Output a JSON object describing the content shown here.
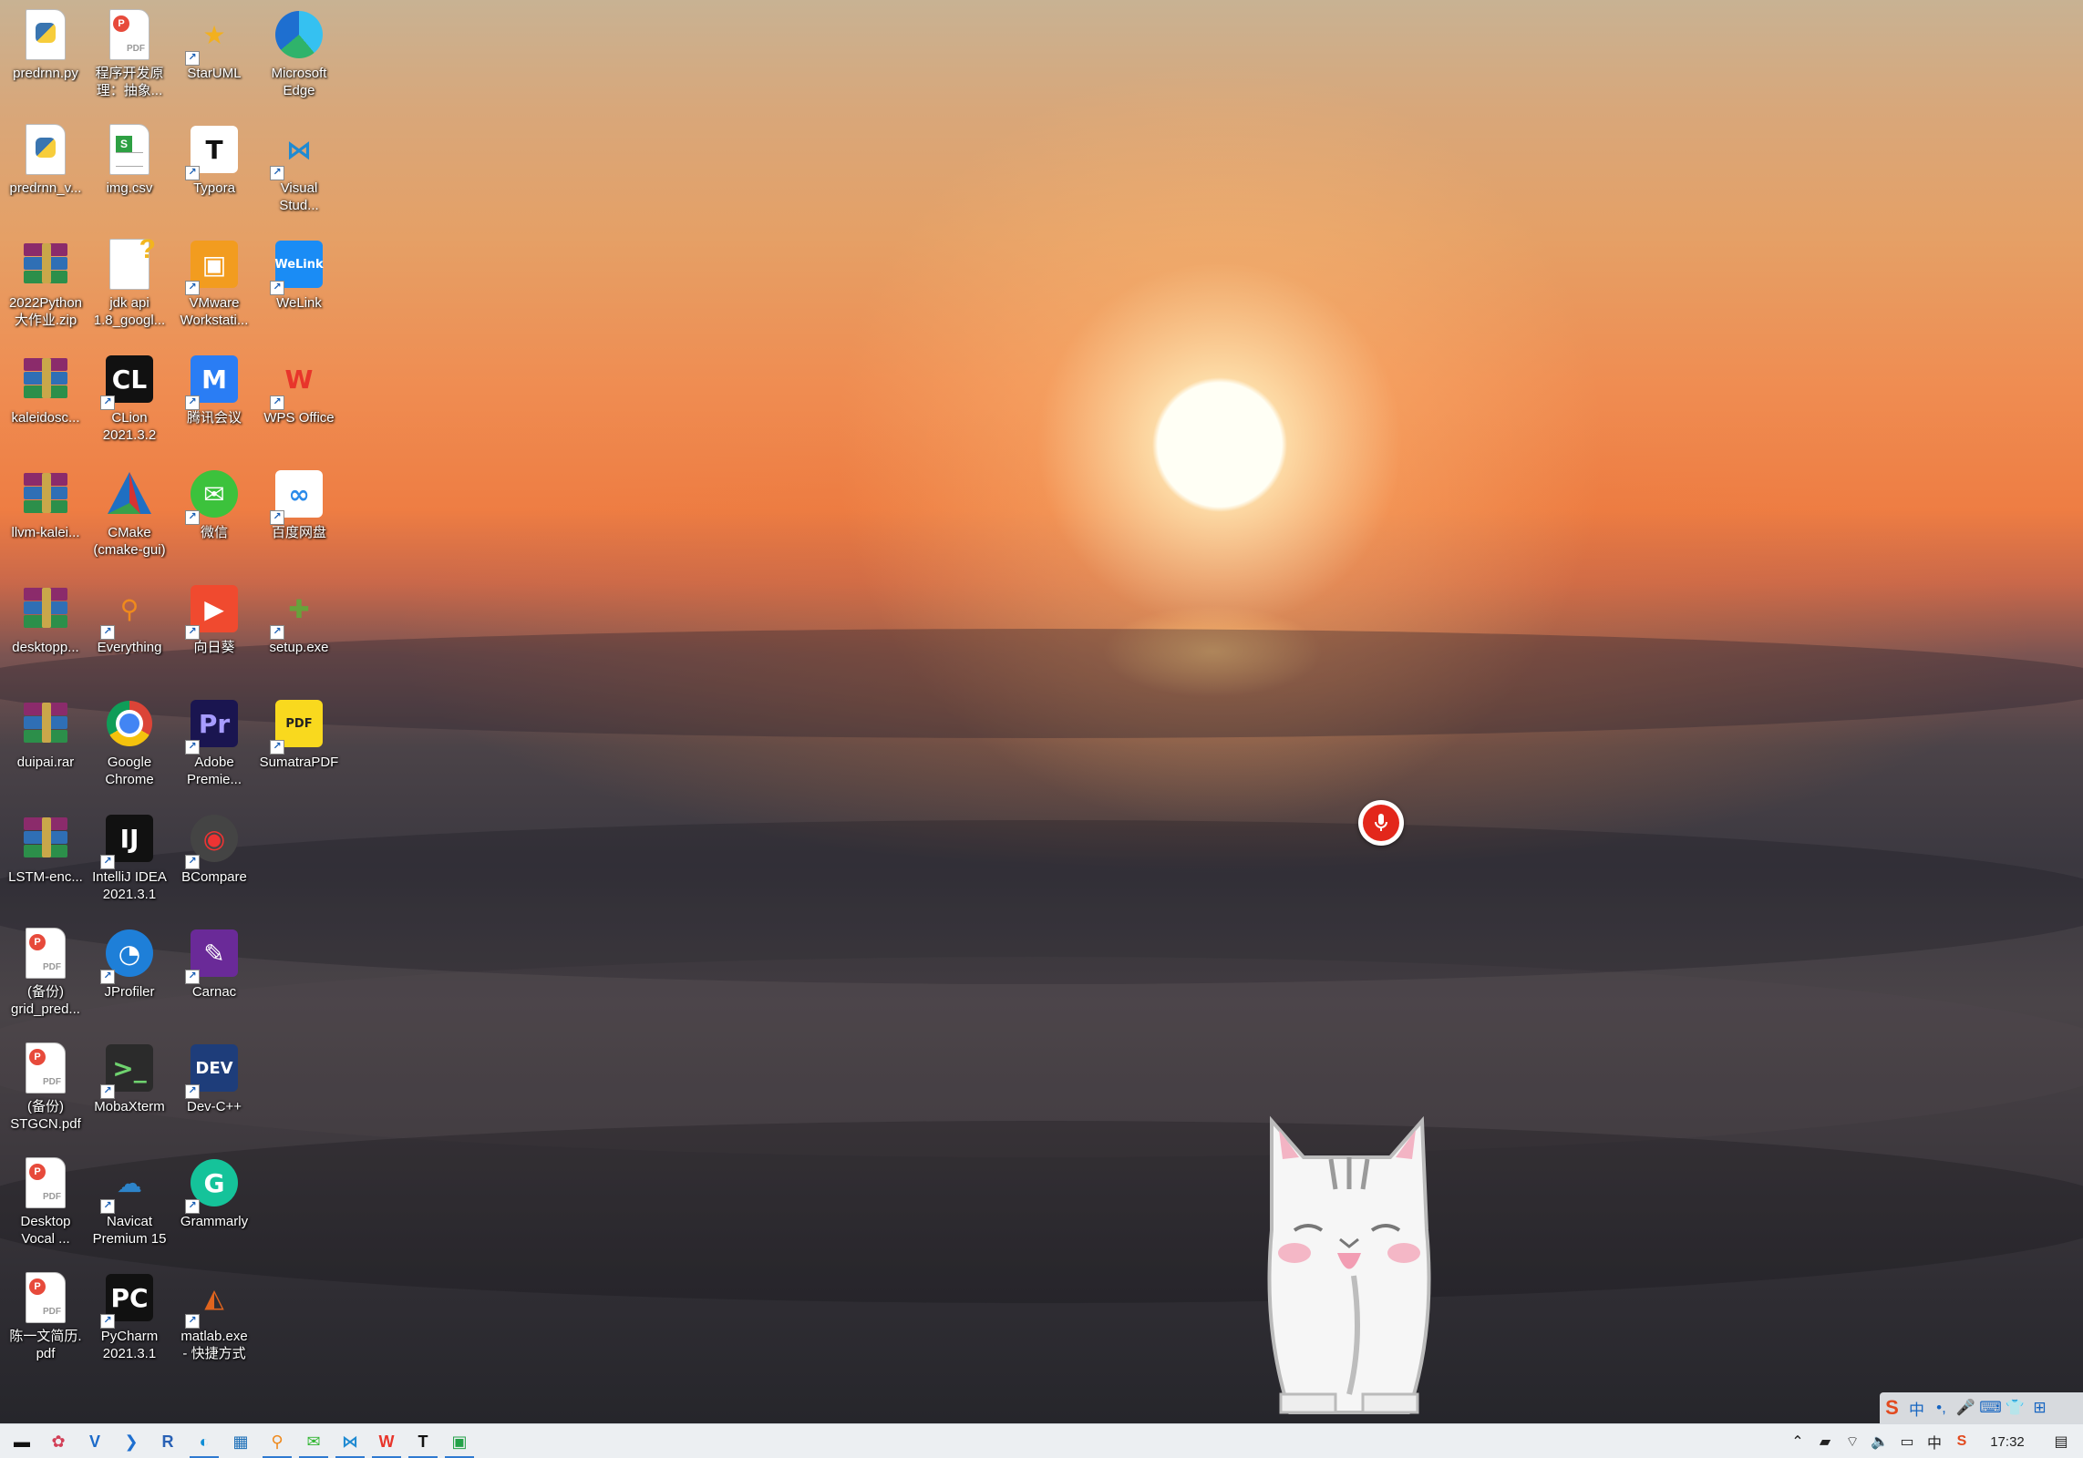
{
  "desktop": {
    "columns": [
      [
        {
          "name": "predrnn-py-file",
          "label": "predrnn.py",
          "kind": "python"
        },
        {
          "name": "predrnn-v-file",
          "label": "predrnn_v...",
          "kind": "python"
        },
        {
          "name": "python-project-zip",
          "label": "2022Python\n大作业.zip",
          "kind": "rar"
        },
        {
          "name": "kaleidosc-archive",
          "label": "kaleidosc...",
          "kind": "rar"
        },
        {
          "name": "llvm-kalei-archive",
          "label": "llvm-kalei...",
          "kind": "rar"
        },
        {
          "name": "desktopp-archive",
          "label": "desktopp...",
          "kind": "rar"
        },
        {
          "name": "duipai-rar",
          "label": "duipai.rar",
          "kind": "rar"
        },
        {
          "name": "lstm-enc-archive",
          "label": "LSTM-enc...",
          "kind": "rar"
        },
        {
          "name": "grid-pred-pdf",
          "label": "(备份)\ngrid_pred...",
          "kind": "pdf"
        },
        {
          "name": "stgcn-pdf",
          "label": "(备份)\nSTGCN.pdf",
          "kind": "pdf"
        },
        {
          "name": "desktop-vocal-pdf",
          "label": "Desktop\nVocal ...",
          "kind": "pdf"
        },
        {
          "name": "resume-pdf",
          "label": "陈一文简历.\npdf",
          "kind": "pdf"
        }
      ],
      [
        {
          "name": "principles-pdf",
          "label": "程序开发原\n理：抽象...",
          "kind": "pdf"
        },
        {
          "name": "img-csv",
          "label": "img.csv",
          "kind": "csv"
        },
        {
          "name": "jdk-api-doc",
          "label": "jdk api\n1.8_googl...",
          "kind": "help"
        },
        {
          "name": "clion-shortcut",
          "label": "CLion\n2021.3.2",
          "kind": "app",
          "bg": "#111",
          "fg": "#fff",
          "text": "CL"
        },
        {
          "name": "cmake-gui-shortcut",
          "label": "CMake\n(cmake-gui)",
          "kind": "cmake"
        },
        {
          "name": "everything-shortcut",
          "label": "Everything",
          "kind": "app",
          "bg": "transparent",
          "fg": "#f08a1c",
          "text": "⚲"
        },
        {
          "name": "google-chrome-shortcut",
          "label": "Google\nChrome",
          "kind": "chrome"
        },
        {
          "name": "intellij-idea-shortcut",
          "label": "IntelliJ IDEA\n2021.3.1",
          "kind": "app",
          "bg": "#111",
          "fg": "#fff",
          "text": "IJ"
        },
        {
          "name": "jprofiler-shortcut",
          "label": "JProfiler",
          "kind": "app",
          "bg": "#1e7fd8",
          "fg": "#fff",
          "text": "◔",
          "round": true
        },
        {
          "name": "mobaxterm-shortcut",
          "label": "MobaXterm",
          "kind": "app",
          "bg": "#2b2b2b",
          "fg": "#6fd36f",
          "text": ">_"
        },
        {
          "name": "navicat-shortcut",
          "label": "Navicat\nPremium 15",
          "kind": "app",
          "bg": "transparent",
          "fg": "#2d83c9",
          "text": "☁"
        },
        {
          "name": "pycharm-shortcut",
          "label": "PyCharm\n2021.3.1",
          "kind": "app",
          "bg": "#111",
          "fg": "#fff",
          "text": "PC"
        }
      ],
      [
        {
          "name": "staruml-shortcut",
          "label": "StarUML",
          "kind": "app",
          "bg": "transparent",
          "fg": "#f2b01e",
          "text": "★"
        },
        {
          "name": "typora-shortcut",
          "label": "Typora",
          "kind": "app",
          "bg": "#fff",
          "fg": "#111",
          "text": "T"
        },
        {
          "name": "vmware-shortcut",
          "label": "VMware\nWorkstati...",
          "kind": "app",
          "bg": "#f29c1f",
          "fg": "#fff",
          "text": "▣"
        },
        {
          "name": "tencent-meeting-shortcut",
          "label": "腾讯会议",
          "kind": "app",
          "bg": "#2a7df4",
          "fg": "#fff",
          "text": "M"
        },
        {
          "name": "wechat-shortcut",
          "label": "微信",
          "kind": "app",
          "bg": "#3cc23c",
          "fg": "#fff",
          "text": "✉",
          "round": true
        },
        {
          "name": "sunlogin-shortcut",
          "label": "向日葵",
          "kind": "app",
          "bg": "#f04a2f",
          "fg": "#fff",
          "text": "▶"
        },
        {
          "name": "adobe-premiere-shortcut",
          "label": "Adobe\nPremie...",
          "kind": "app",
          "bg": "#1a1550",
          "fg": "#a79cff",
          "text": "Pr"
        },
        {
          "name": "bcompare-shortcut",
          "label": "BCompare",
          "kind": "app",
          "bg": "#444",
          "fg": "#e33",
          "text": "◉",
          "round": true
        },
        {
          "name": "carnac-shortcut",
          "label": "Carnac",
          "kind": "app",
          "bg": "#6a2a98",
          "fg": "#fff",
          "text": "✎"
        },
        {
          "name": "dev-cpp-shortcut",
          "label": "Dev-C++",
          "kind": "app",
          "bg": "#1e3d7a",
          "fg": "#fff",
          "text": "DEV"
        },
        {
          "name": "grammarly-shortcut",
          "label": "Grammarly",
          "kind": "app",
          "bg": "#15c39a",
          "fg": "#fff",
          "text": "G",
          "round": true
        },
        {
          "name": "matlab-shortcut",
          "label": "matlab.exe\n- 快捷方式",
          "kind": "app",
          "bg": "transparent",
          "fg": "#e0641e",
          "text": "◭"
        }
      ],
      [
        {
          "name": "microsoft-edge-shortcut",
          "label": "Microsoft\nEdge",
          "kind": "edge"
        },
        {
          "name": "vscode-shortcut",
          "label": "Visual\nStud...",
          "kind": "app",
          "bg": "transparent",
          "fg": "#1f8ad2",
          "text": "⋈"
        },
        {
          "name": "welink-shortcut",
          "label": "WeLink",
          "kind": "app",
          "bg": "#1a8cf5",
          "fg": "#fff",
          "text": "WeLink",
          "small": true
        },
        {
          "name": "wps-office-shortcut",
          "label": "WPS Office",
          "kind": "app",
          "bg": "transparent",
          "fg": "#e8352b",
          "text": "W"
        },
        {
          "name": "baidu-netdisk-shortcut",
          "label": "百度网盘",
          "kind": "app",
          "bg": "#fff",
          "fg": "#2b8bea",
          "text": "∞"
        },
        {
          "name": "setup-exe",
          "label": "setup.exe",
          "kind": "app",
          "bg": "transparent",
          "fg": "#66a33b",
          "text": "✚"
        },
        {
          "name": "sumatrapdf-shortcut",
          "label": "SumatraPDF",
          "kind": "app",
          "bg": "#f9d91e",
          "fg": "#222",
          "text": "PDF",
          "small": true
        }
      ]
    ]
  },
  "widgets": {
    "mic_label": "voice input",
    "pet_label": "desktop pet cat"
  },
  "taskbar": {
    "apps": [
      {
        "name": "taskbar-start-terminal",
        "glyph": "▬",
        "color": "#111",
        "running": false
      },
      {
        "name": "taskbar-app-2",
        "glyph": "✿",
        "color": "#d23f57",
        "running": false
      },
      {
        "name": "taskbar-app-3",
        "glyph": "V",
        "color": "#1b6ac9",
        "running": false
      },
      {
        "name": "taskbar-app-4",
        "glyph": "❯",
        "color": "#1e6fd0",
        "running": false
      },
      {
        "name": "taskbar-app-r",
        "glyph": "R",
        "color": "#2961b5",
        "running": false
      },
      {
        "name": "taskbar-edge",
        "glyph": "◐",
        "color": "#0f8dd6",
        "running": true
      },
      {
        "name": "taskbar-app-7",
        "glyph": "▦",
        "color": "#1d6fb8",
        "running": false
      },
      {
        "name": "taskbar-everything",
        "glyph": "⚲",
        "color": "#ef8a1d",
        "running": true
      },
      {
        "name": "taskbar-wechat",
        "glyph": "✉",
        "color": "#32b632",
        "running": true
      },
      {
        "name": "taskbar-vscode",
        "glyph": "⋈",
        "color": "#1f8ad2",
        "running": true
      },
      {
        "name": "taskbar-wps",
        "glyph": "W",
        "color": "#e8352b",
        "running": true
      },
      {
        "name": "taskbar-typora",
        "glyph": "T",
        "color": "#111",
        "running": true
      },
      {
        "name": "taskbar-pycharm",
        "glyph": "▣",
        "color": "#24a148",
        "running": true
      }
    ],
    "tray": {
      "clock": "17:32",
      "icons": [
        "chevron-up-icon",
        "bookmark-icon",
        "wifi-icon",
        "volume-icon",
        "battery-icon",
        "ime-mode-icon",
        "sogou-icon"
      ]
    }
  },
  "ime": {
    "items": [
      "S",
      "中",
      "•,",
      "🎤",
      "⌨",
      "👕",
      "⊞"
    ]
  }
}
